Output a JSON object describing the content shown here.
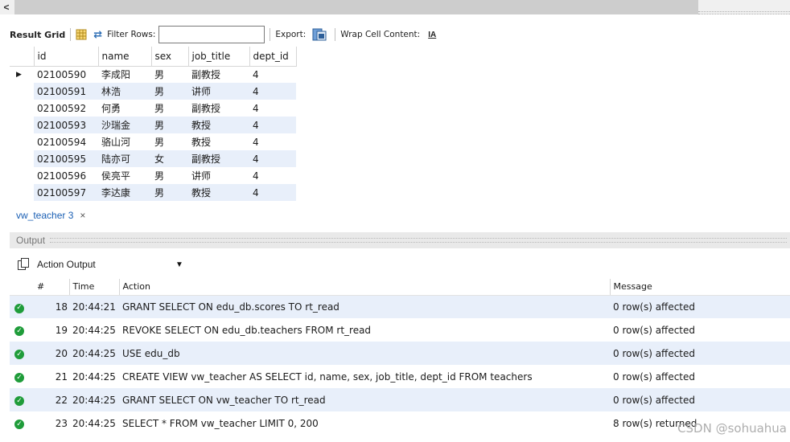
{
  "scroll": {
    "left_arrow": "<"
  },
  "toolbar": {
    "result_grid": "Result Grid",
    "filter_rows_label": "Filter Rows:",
    "filter_value": "",
    "export_label": "Export:",
    "wrap_label": "Wrap Cell Content:",
    "wrap_icon_text": "IA"
  },
  "result": {
    "columns": [
      "id",
      "name",
      "sex",
      "job_title",
      "dept_id"
    ],
    "rows": [
      [
        "02100590",
        "李成阳",
        "男",
        "副教授",
        "4"
      ],
      [
        "02100591",
        "林浩",
        "男",
        "讲师",
        "4"
      ],
      [
        "02100592",
        "何勇",
        "男",
        "副教授",
        "4"
      ],
      [
        "02100593",
        "沙瑞金",
        "男",
        "教授",
        "4"
      ],
      [
        "02100594",
        "骆山河",
        "男",
        "教授",
        "4"
      ],
      [
        "02100595",
        "陆亦可",
        "女",
        "副教授",
        "4"
      ],
      [
        "02100596",
        "侯亮平",
        "男",
        "讲师",
        "4"
      ],
      [
        "02100597",
        "李达康",
        "男",
        "教授",
        "4"
      ]
    ],
    "current_row_marker": "▶"
  },
  "tab": {
    "label": "vw_teacher 3",
    "close": "×"
  },
  "output": {
    "title": "Output",
    "selector_value": "Action Output",
    "columns": {
      "num": "#",
      "time": "Time",
      "action": "Action",
      "message": "Message"
    },
    "rows": [
      {
        "num": "18",
        "time": "20:44:21",
        "action": "GRANT SELECT ON edu_db.scores TO rt_read",
        "message": "0 row(s) affected"
      },
      {
        "num": "19",
        "time": "20:44:25",
        "action": "REVOKE SELECT ON edu_db.teachers FROM rt_read",
        "message": "0 row(s) affected"
      },
      {
        "num": "20",
        "time": "20:44:25",
        "action": "USE edu_db",
        "message": "0 row(s) affected"
      },
      {
        "num": "21",
        "time": "20:44:25",
        "action": "CREATE VIEW vw_teacher AS SELECT id, name, sex, job_title, dept_id FROM teachers",
        "message": "0 row(s) affected"
      },
      {
        "num": "22",
        "time": "20:44:25",
        "action": "GRANT SELECT ON vw_teacher TO rt_read",
        "message": "0 row(s) affected"
      },
      {
        "num": "23",
        "time": "20:44:25",
        "action": "SELECT * FROM vw_teacher LIMIT 0, 200",
        "message": "8 row(s) returned"
      }
    ]
  },
  "watermark": "CSDN @sohuahua",
  "colors": {
    "alt_row": "#e8effa",
    "ok_green": "#1f9c3a",
    "tab_text": "#1a5fb4"
  }
}
